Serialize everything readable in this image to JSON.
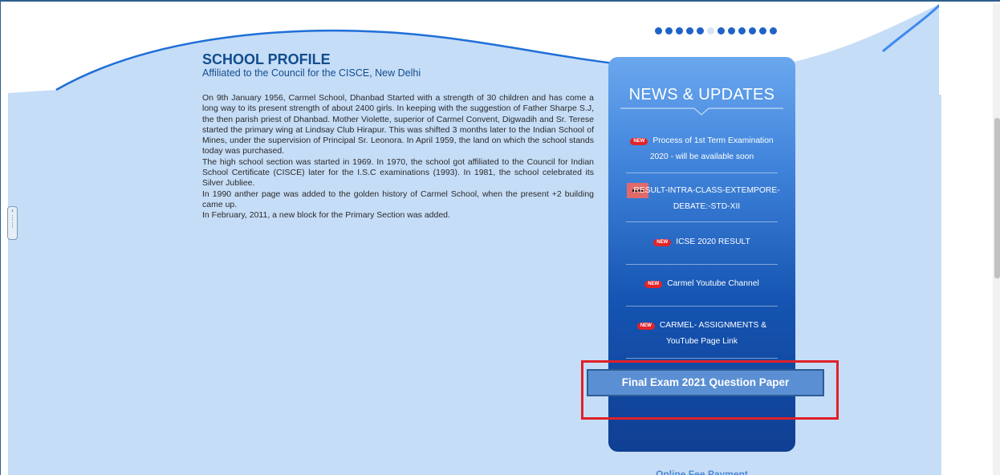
{
  "slider": {
    "dots_total": 12,
    "active_dot": 6
  },
  "profile": {
    "title": "SCHOOL PROFILE",
    "subtitle": "Affiliated to the Council for the CISCE, New Delhi",
    "paragraphs": [
      "On 9th January 1956, Carmel School, Dhanbad Started with a strength of 30 children and has come a long way to its present strength of about 2400 girls. In keeping with the suggestion of Father Sharpe S.J, the then parish priest of Dhanbad. Mother Violette, superior of Carmel Convent, Digwadih and Sr. Terese started the primary wing at Lindsay Club Hirapur. This was shifted 3 months later to the Indian School of Mines, under the supervision of Principal Sr. Leonora. In April 1959, the land on which the school stands today was purchased.",
      "The high school section was started in 1969. In 1970, the school got affiliated to the Council for Indian School Certificate (CISCE) later for the I.S.C examinations (1993).  In 1981, the school celebrated its Silver Jubliee.",
      "In 1990 anther page was added to the golden history of Carmel School, when the present +2 building came up.",
      "In February, 2011, a new block for the Primary Section was added."
    ]
  },
  "news": {
    "title": "NEWS & UPDATES",
    "badge_label": "NEW",
    "items": [
      {
        "text": "Process of 1st Term Examination 2020 - will be available soon",
        "is_new": true
      },
      {
        "text": "RESULT-INTRA-CLASS-EXTEMPORE-DEBATE:-STD-XII",
        "is_new": false
      },
      {
        "text": "ICSE 2020 RESULT",
        "is_new": true
      },
      {
        "text": "Carmel Youtube Channel",
        "is_new": true
      },
      {
        "text": "CARMEL- ASSIGNMENTS & YouTube Page Link",
        "is_new": true
      }
    ]
  },
  "final_exam_button": {
    "label": "Final Exam 2021 Question Paper"
  },
  "online_fee": {
    "label": "Online Fee Payment"
  },
  "side_toggle": {
    "glyph": "›"
  },
  "icons": {
    "side_toggle": "grip-icon",
    "news_underline": "chevron-underline-icon",
    "result_item": "minus-square-icon"
  },
  "colors": {
    "page_background": "#c6ddf7",
    "profile_heading": "#124d8d",
    "news_panel_top": "#6aa7ee",
    "news_panel_bottom": "#0f3f92",
    "highlight": "#e0202a",
    "button": "#5b8fd3",
    "new_badge": "#e2232a",
    "slider_dot": "#1f63c8"
  }
}
